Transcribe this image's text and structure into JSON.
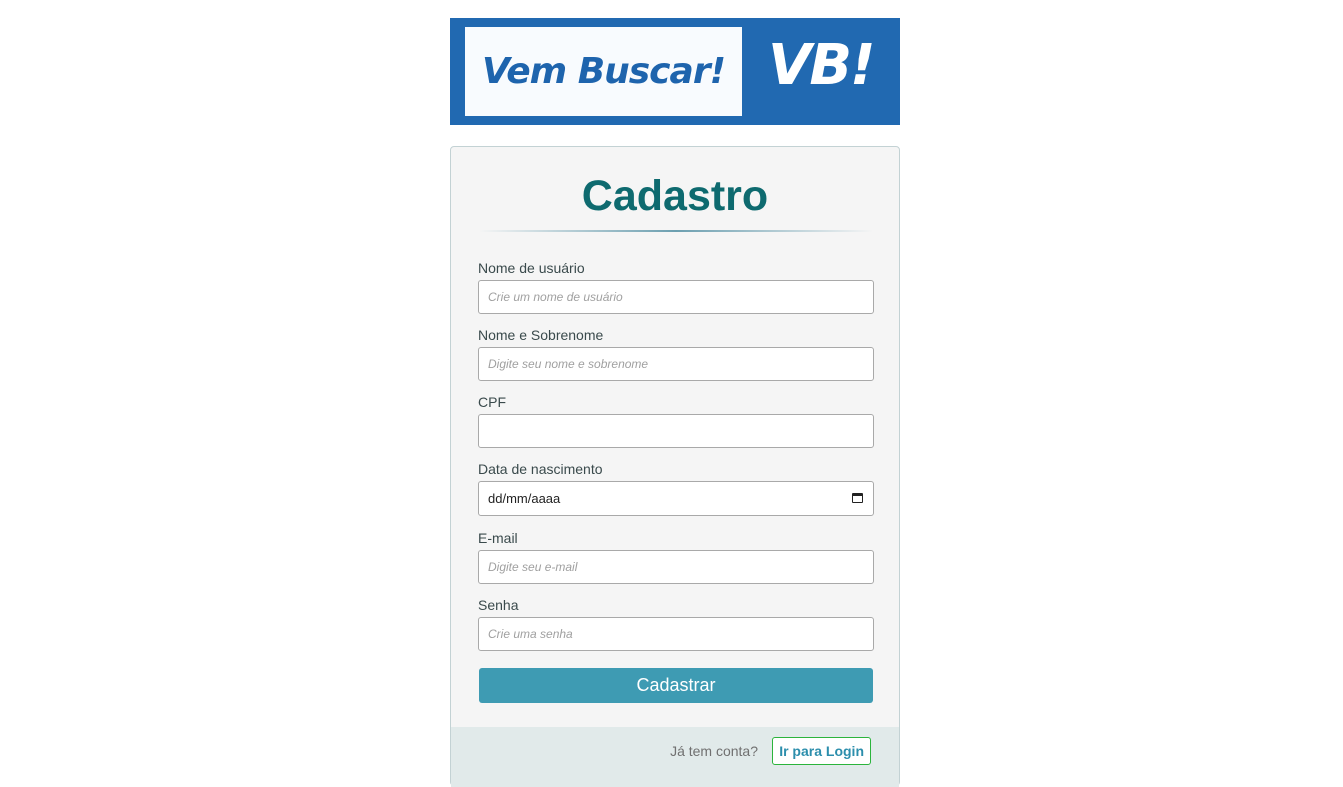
{
  "banner": {
    "text": "Vem Buscar!",
    "mark": "VB!"
  },
  "form": {
    "title": "Cadastro",
    "fields": [
      {
        "label": "Nome de usuário",
        "placeholder": "Crie um nome de usuário",
        "value": ""
      },
      {
        "label": "Nome e Sobrenome",
        "placeholder": "Digite seu nome e sobrenome",
        "value": ""
      },
      {
        "label": "CPF",
        "placeholder": "",
        "value": ""
      },
      {
        "label": "Data de nascimento",
        "placeholder": "",
        "value": "dd/mm/aaaa"
      },
      {
        "label": "E-mail",
        "placeholder": "Digite seu e-mail",
        "value": ""
      },
      {
        "label": "Senha",
        "placeholder": "Crie uma senha",
        "value": ""
      }
    ],
    "submit_label": "Cadastrar"
  },
  "footer": {
    "prompt": "Já tem conta?",
    "login_label": "Ir para Login"
  },
  "colors": {
    "brand_blue": "#2169b1",
    "title_teal": "#0e6a6f",
    "button_teal": "#3e9bb3",
    "login_border_green": "#2bb43c"
  }
}
